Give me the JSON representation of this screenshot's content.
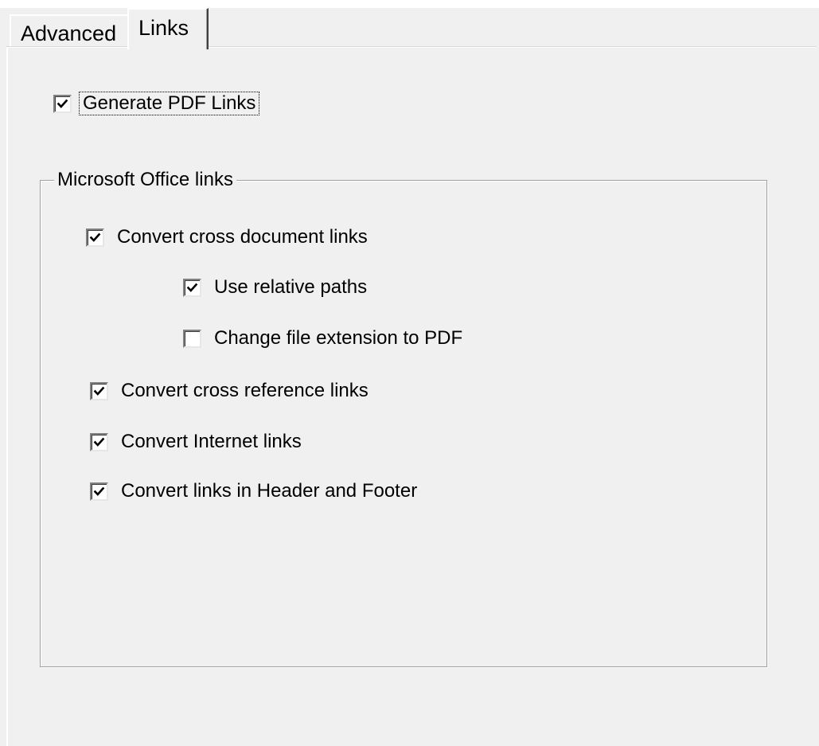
{
  "tabs": {
    "advanced_label": "Advanced",
    "links_label": "Links"
  },
  "generate_pdf_links": {
    "label": "Generate PDF Links",
    "checked": true
  },
  "office_links_group": {
    "legend": "Microsoft Office links",
    "cross_document": {
      "label": "Convert cross document links",
      "checked": true
    },
    "relative_paths": {
      "label": "Use relative paths",
      "checked": true
    },
    "change_extension": {
      "label": "Change file extension to PDF",
      "checked": false
    },
    "cross_reference": {
      "label": "Convert cross reference links",
      "checked": true
    },
    "internet_links": {
      "label": "Convert Internet links",
      "checked": true
    },
    "header_footer": {
      "label": "Convert links in Header and Footer",
      "checked": true
    }
  }
}
